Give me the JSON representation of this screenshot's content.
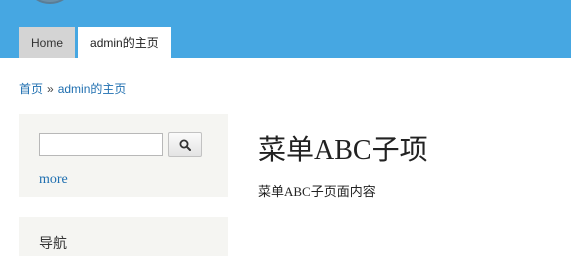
{
  "header": {
    "color": "#46a7e2",
    "tabs": [
      {
        "label": "Home"
      },
      {
        "label": "admin的主页"
      }
    ]
  },
  "breadcrumb": {
    "home": "首页",
    "separator": "»",
    "current": "admin的主页"
  },
  "sidebar": {
    "search": {
      "value": "",
      "placeholder": "",
      "button_icon": "search-icon",
      "more_label": "more"
    },
    "nav": {
      "title": "导航"
    }
  },
  "main": {
    "title": "菜单ABC子项",
    "body": "菜单ABC子页面内容"
  }
}
